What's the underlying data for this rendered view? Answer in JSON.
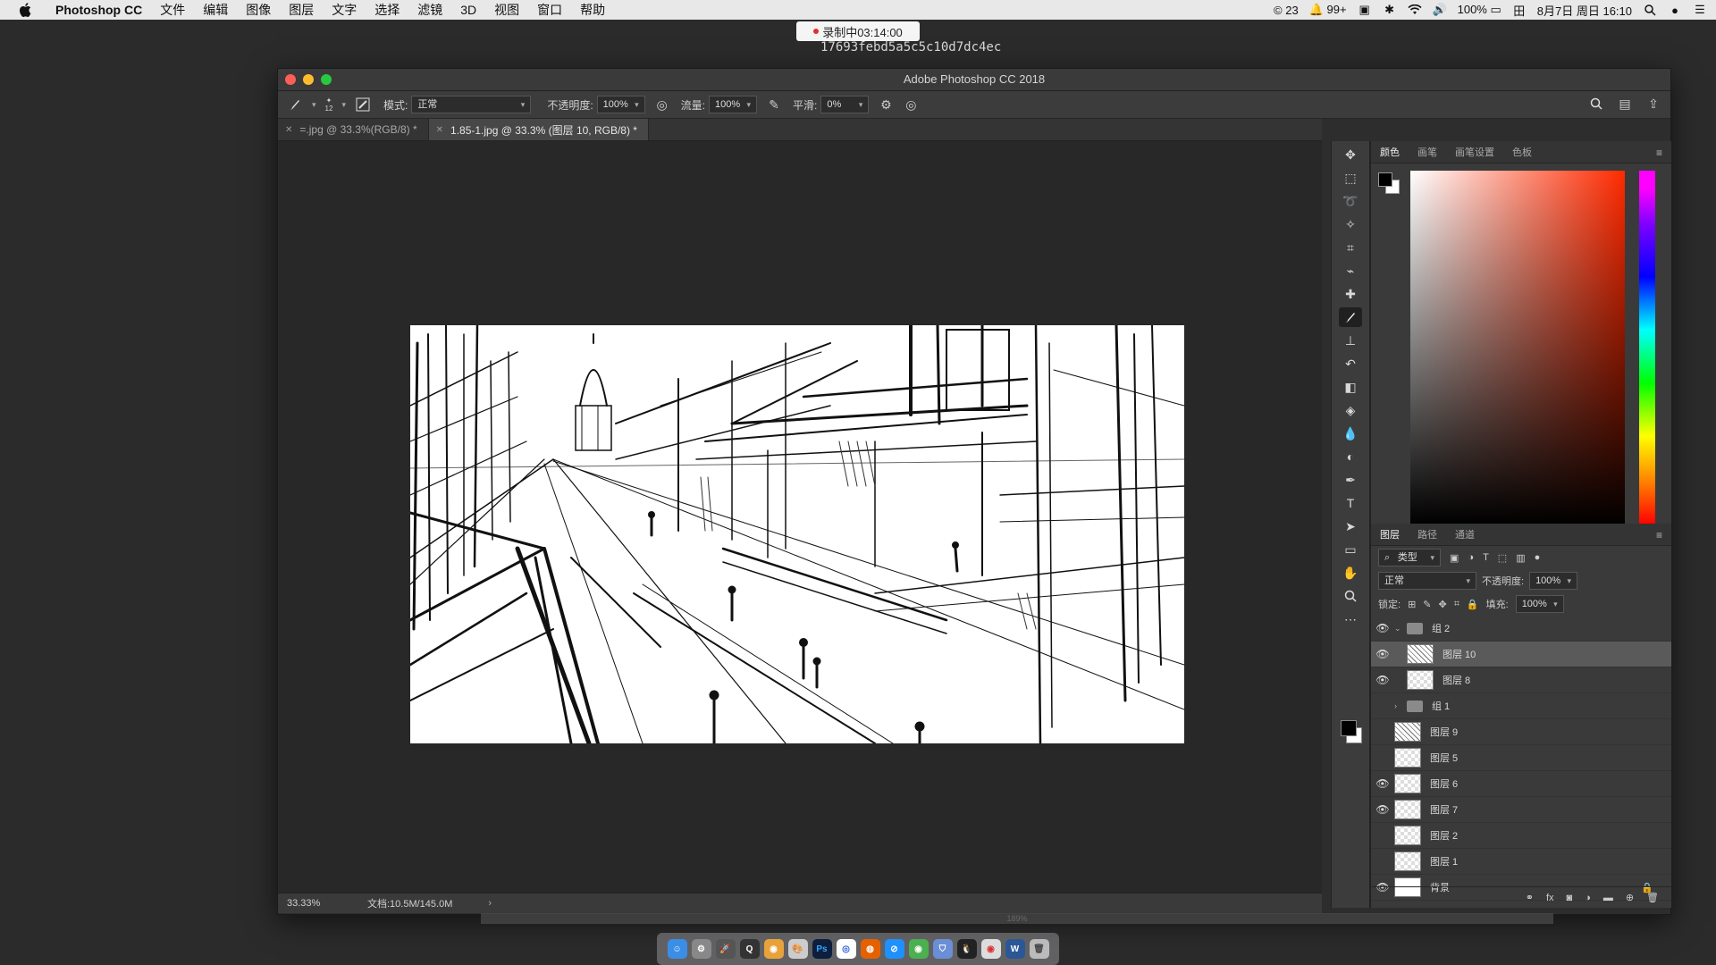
{
  "menubar": {
    "app_name": "Photoshop CC",
    "items": [
      "文件",
      "编辑",
      "图像",
      "图层",
      "文字",
      "选择",
      "滤镜",
      "3D",
      "视图",
      "窗口",
      "帮助"
    ],
    "status": {
      "notif_count_1": "23",
      "notif_count_2": "99+",
      "battery": "100%",
      "datetime": "8月7日 周日 16:10"
    }
  },
  "recording": {
    "label": "录制中03:14:00",
    "hash": "17693febd5a5c5c10d7dc4ec"
  },
  "window": {
    "title": "Adobe Photoshop CC 2018"
  },
  "options_bar": {
    "brush_size": "12",
    "mode_label": "模式:",
    "mode_value": "正常",
    "opacity_label": "不透明度:",
    "opacity_value": "100%",
    "flow_label": "流量:",
    "flow_value": "100%",
    "smoothing_label": "平滑:",
    "smoothing_value": "0%"
  },
  "doc_tabs": [
    {
      "label": "=.jpg @ 33.3%(RGB/8) *",
      "active": false
    },
    {
      "label": "1.85-1.jpg @ 33.3% (图层 10, RGB/8) *",
      "active": true
    }
  ],
  "status_bar": {
    "zoom": "33.33%",
    "doc_size": "文档:10.5M/145.0M"
  },
  "color_panel": {
    "tabs": [
      "颜色",
      "画笔",
      "画笔设置",
      "色板"
    ],
    "active_tab": 0
  },
  "layers_panel": {
    "tabs": [
      "图层",
      "路径",
      "通道"
    ],
    "filter_label": "类型",
    "blend_mode": "正常",
    "opacity_label": "不透明度:",
    "opacity_value": "100%",
    "lock_label": "锁定:",
    "fill_label": "填充:",
    "fill_value": "100%",
    "layers": [
      {
        "name": "组 2",
        "type": "group",
        "expanded": true,
        "visible": true
      },
      {
        "name": "图层 10",
        "type": "layer",
        "visible": true,
        "selected": true,
        "indent": true
      },
      {
        "name": "图层 8",
        "type": "layer",
        "visible": true,
        "indent": true
      },
      {
        "name": "组 1",
        "type": "group",
        "expanded": false,
        "visible": false
      },
      {
        "name": "图层 9",
        "type": "layer",
        "visible": false
      },
      {
        "name": "图层 5",
        "type": "layer",
        "visible": false
      },
      {
        "name": "图层 6",
        "type": "layer",
        "visible": true
      },
      {
        "name": "图层 7",
        "type": "layer",
        "visible": true
      },
      {
        "name": "图层 2",
        "type": "layer",
        "visible": false
      },
      {
        "name": "图层 1",
        "type": "layer",
        "visible": false
      },
      {
        "name": "背景",
        "type": "background",
        "visible": true
      }
    ]
  },
  "tools": [
    "move-tool",
    "marquee-tool",
    "lasso-tool",
    "magic-wand-tool",
    "crop-tool",
    "eyedropper-tool",
    "healing-tool",
    "brush-tool",
    "stamp-tool",
    "history-brush-tool",
    "eraser-tool",
    "paint-bucket-tool",
    "blur-tool",
    "dodge-tool",
    "pen-tool",
    "type-tool",
    "path-select-tool",
    "rectangle-tool",
    "hand-tool",
    "zoom-tool",
    "more-tools"
  ],
  "active_tool": "brush-tool",
  "background_strip": {
    "zoom": "189%"
  },
  "dock": [
    "finder",
    "system-prefs",
    "launchpad",
    "quicktime",
    "chrome",
    "palette",
    "photoshop",
    "baidu",
    "firefox",
    "safari",
    "chrome-2",
    "vpn",
    "qq",
    "chrome-3",
    "word",
    "trash"
  ]
}
